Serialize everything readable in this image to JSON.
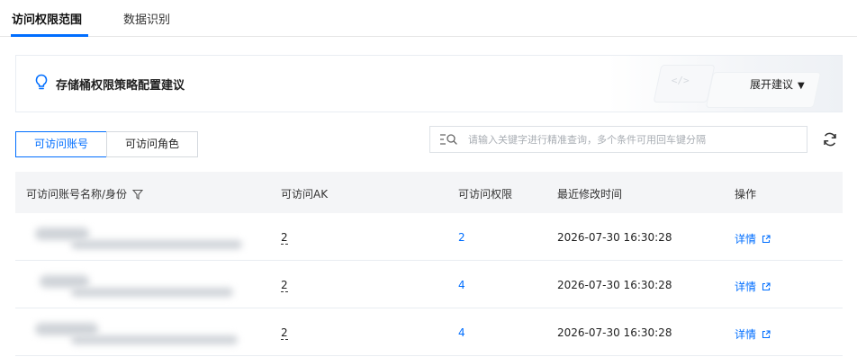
{
  "tabs": [
    {
      "label": "访问权限范围",
      "active": true
    },
    {
      "label": "数据识别",
      "active": false
    }
  ],
  "banner": {
    "title": "存储桶权限策略配置建议",
    "expand_label": "展开建议",
    "deco_code": "</>"
  },
  "segments": [
    {
      "label": "可访问账号",
      "active": true
    },
    {
      "label": "可访问角色",
      "active": false
    }
  ],
  "search": {
    "placeholder": "请输入关键字进行精准查询，多个条件可用回车键分隔",
    "value": ""
  },
  "table": {
    "columns": [
      "可访问账号名称/身份",
      "可访问AK",
      "可访问权限",
      "最近修改时间",
      "操作"
    ],
    "rows": [
      {
        "ak": "2",
        "permissions": "2",
        "modified": "2026-07-30 16:30:28",
        "action": "详情"
      },
      {
        "ak": "2",
        "permissions": "4",
        "modified": "2026-07-30 16:30:28",
        "action": "详情"
      },
      {
        "ak": "2",
        "permissions": "4",
        "modified": "2026-07-30 16:30:28",
        "action": "详情"
      }
    ]
  },
  "colors": {
    "accent": "#006eff",
    "header_bg": "#f4f5f7",
    "border": "#e9edf2"
  },
  "icons": [
    "bulb-icon",
    "caret-down-icon",
    "search-filter-icon",
    "refresh-icon",
    "filter-icon",
    "external-link-icon"
  ]
}
